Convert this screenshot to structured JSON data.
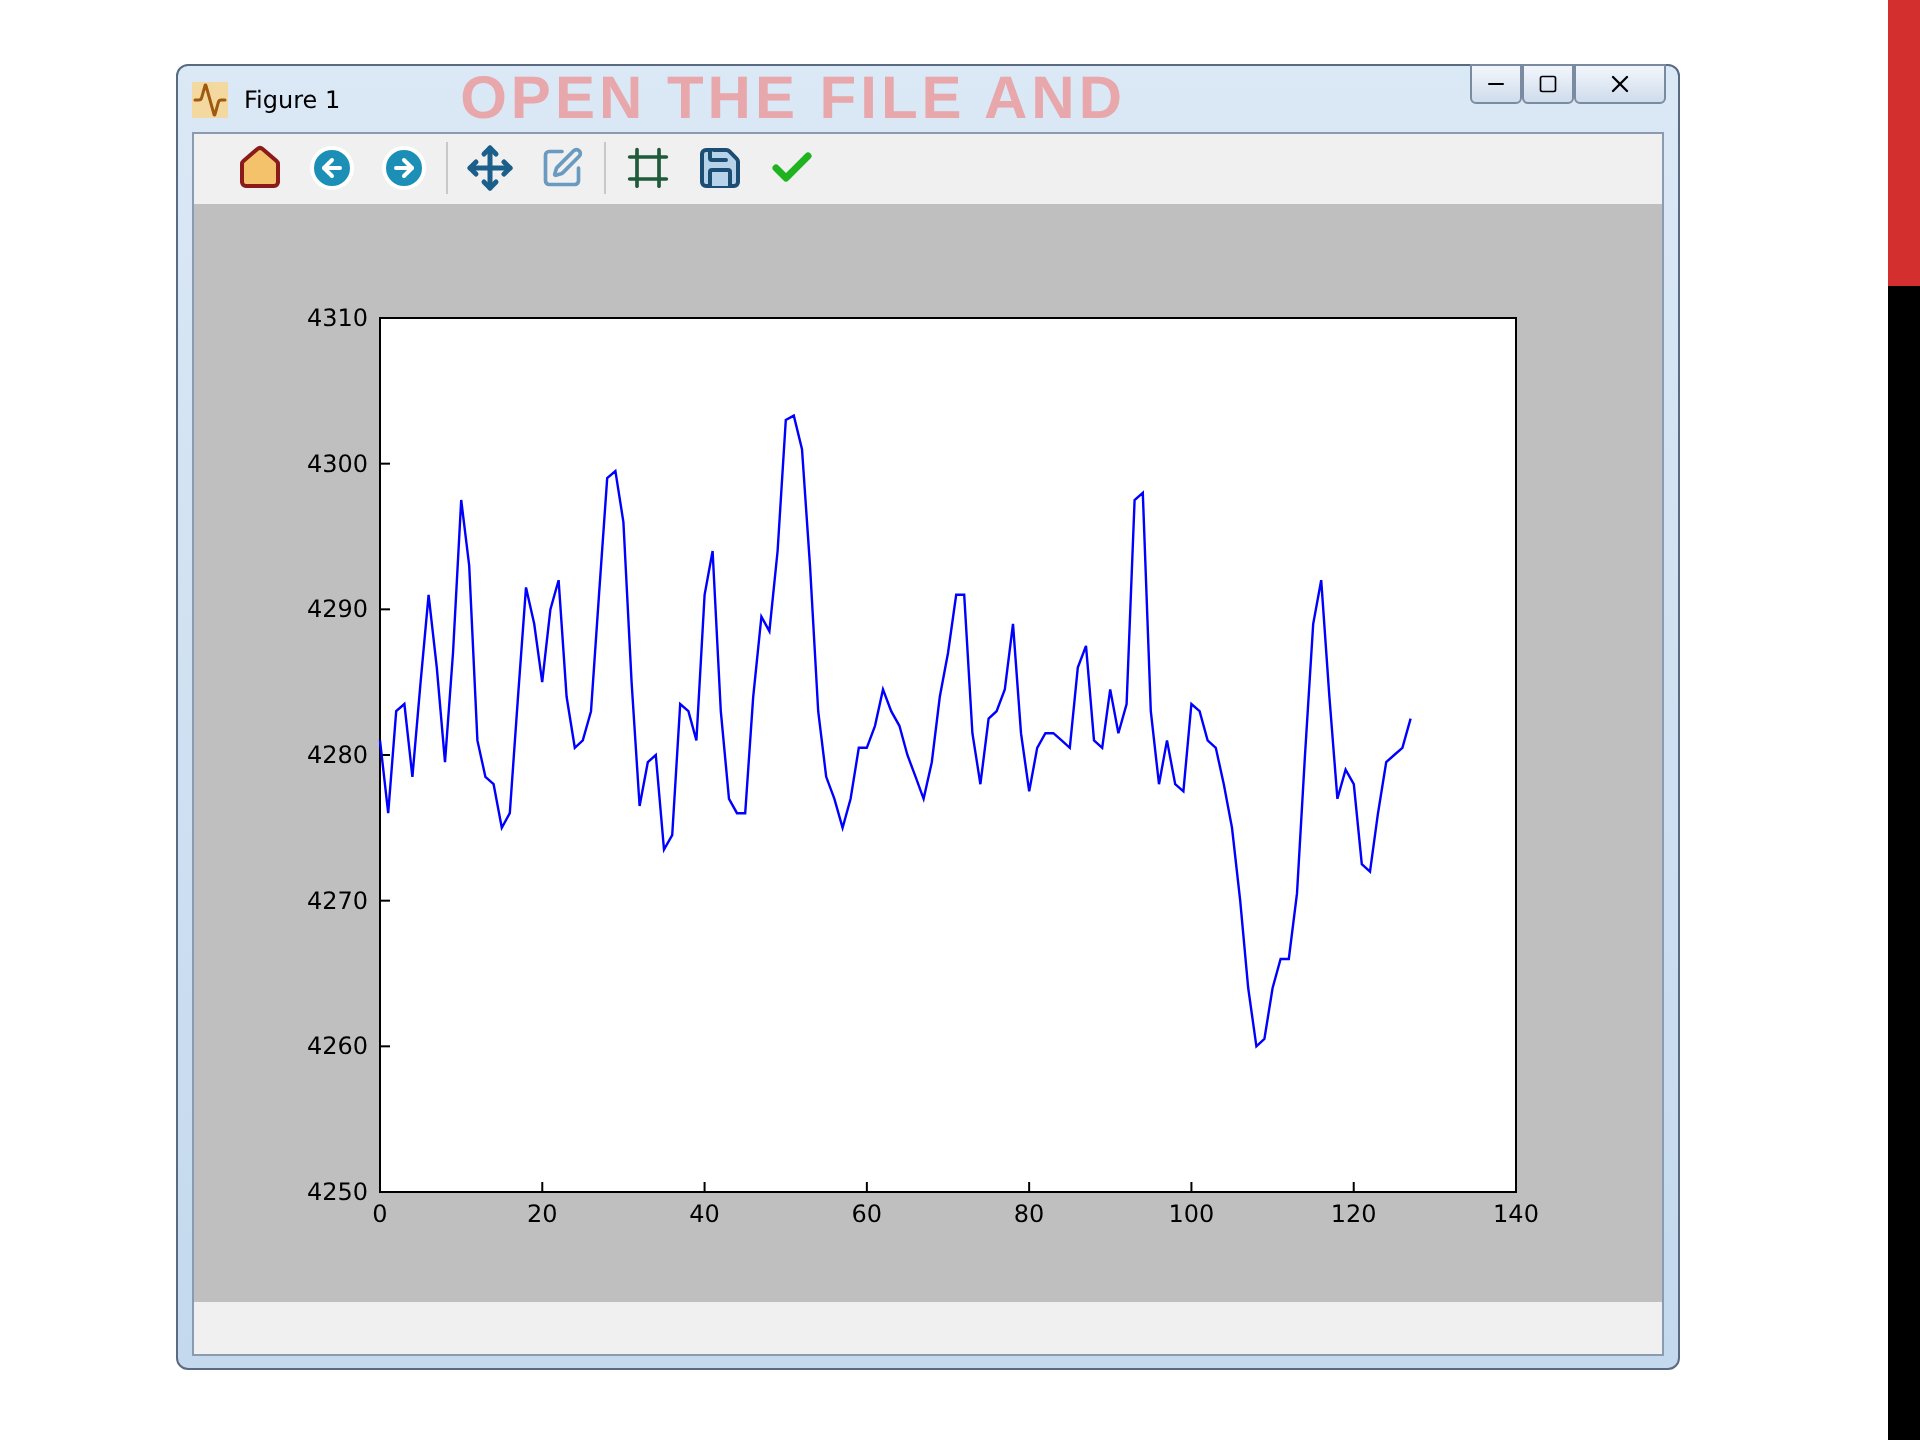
{
  "slide": {
    "title": "OPEN THE FILE AND"
  },
  "window": {
    "title": "Figure 1"
  },
  "chart_data": {
    "type": "line",
    "xlim": [
      0,
      140
    ],
    "ylim": [
      4250,
      4310
    ],
    "xticks": [
      0,
      20,
      40,
      60,
      80,
      100,
      120,
      140
    ],
    "yticks": [
      4250,
      4260,
      4270,
      4280,
      4290,
      4300,
      4310
    ],
    "x": [
      0,
      1,
      2,
      3,
      4,
      5,
      6,
      7,
      8,
      9,
      10,
      11,
      12,
      13,
      14,
      15,
      16,
      17,
      18,
      19,
      20,
      21,
      22,
      23,
      24,
      25,
      26,
      27,
      28,
      29,
      30,
      31,
      32,
      33,
      34,
      35,
      36,
      37,
      38,
      39,
      40,
      41,
      42,
      43,
      44,
      45,
      46,
      47,
      48,
      49,
      50,
      51,
      52,
      53,
      54,
      55,
      56,
      57,
      58,
      59,
      60,
      61,
      62,
      63,
      64,
      65,
      66,
      67,
      68,
      69,
      70,
      71,
      72,
      73,
      74,
      75,
      76,
      77,
      78,
      79,
      80,
      81,
      82,
      83,
      84,
      85,
      86,
      87,
      88,
      89,
      90,
      91,
      92,
      93,
      94,
      95,
      96,
      97,
      98,
      99,
      100,
      101,
      102,
      103,
      104,
      105,
      106,
      107,
      108,
      109,
      110,
      111,
      112,
      113,
      114,
      115,
      116,
      117,
      118,
      119,
      120,
      121,
      122,
      123,
      124,
      125,
      126,
      127
    ],
    "values": [
      4281,
      4276,
      4283,
      4283.5,
      4278.5,
      4285,
      4291,
      4286,
      4279.5,
      4287,
      4297.5,
      4293,
      4281,
      4278.5,
      4278,
      4275,
      4276,
      4284,
      4291.5,
      4289,
      4285,
      4290,
      4292,
      4284,
      4280.5,
      4281,
      4283,
      4291,
      4299,
      4299.5,
      4296,
      4285,
      4276.5,
      4279.5,
      4280,
      4273.5,
      4274.5,
      4283.5,
      4283,
      4281,
      4291,
      4294,
      4283,
      4277,
      4276,
      4276,
      4284,
      4289.5,
      4288.5,
      4294,
      4303,
      4303.3,
      4301,
      4293,
      4283,
      4278.5,
      4277,
      4275,
      4277,
      4280.5,
      4280.5,
      4282,
      4284.5,
      4283,
      4282,
      4280,
      4278.5,
      4277,
      4279.5,
      4284,
      4287,
      4291,
      4291,
      4281.5,
      4278,
      4282.5,
      4283,
      4284.5,
      4289,
      4281.5,
      4277.5,
      4280.5,
      4281.5,
      4281.5,
      4281,
      4280.5,
      4286,
      4287.5,
      4281,
      4280.5,
      4284.5,
      4281.5,
      4283.5,
      4297.5,
      4298,
      4283,
      4278,
      4281,
      4278,
      4277.5,
      4283.5,
      4283,
      4281,
      4280.5,
      4278,
      4275,
      4270,
      4264,
      4260,
      4260.5,
      4264,
      4266,
      4266,
      4270.5,
      4280,
      4289,
      4292,
      4284,
      4277,
      4279,
      4278,
      4272.5,
      4272,
      4276,
      4279.5,
      4280,
      4280.5,
      4282.5
    ]
  }
}
